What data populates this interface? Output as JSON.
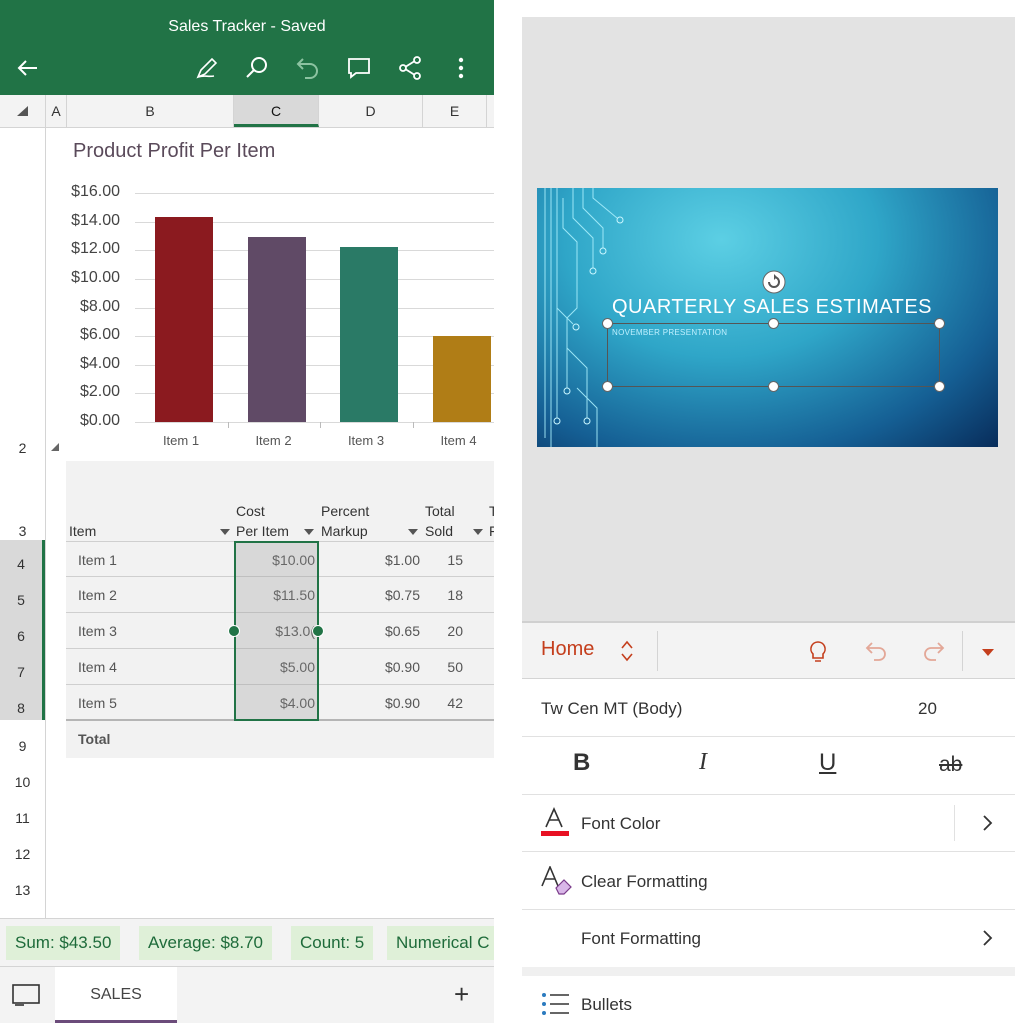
{
  "excel": {
    "title": "Sales Tracker - Saved",
    "toolbar_icons": [
      "back-arrow-icon",
      "pen-icon",
      "search-icon",
      "undo-icon",
      "comment-icon",
      "share-icon",
      "more-icon"
    ],
    "columns": [
      {
        "label": "A",
        "selected": false
      },
      {
        "label": "B",
        "selected": false
      },
      {
        "label": "C",
        "selected": true
      },
      {
        "label": "D",
        "selected": false
      },
      {
        "label": "E",
        "selected": false
      }
    ],
    "rows": [
      "2",
      "3",
      "4",
      "5",
      "6",
      "7",
      "8",
      "9",
      "10",
      "11",
      "12",
      "13"
    ],
    "selected_rows": [
      "4",
      "5",
      "6",
      "7",
      "8"
    ],
    "chart": {
      "title": "Product Profit Per Item",
      "y_ticks": [
        "$16.00",
        "$14.00",
        "$12.00",
        "$10.00",
        "$8.00",
        "$6.00",
        "$4.00",
        "$2.00",
        "$0.00"
      ],
      "categories": [
        "Item 1",
        "Item 2",
        "Item 3",
        "Item 4"
      ],
      "values": [
        14.3,
        12.9,
        12.2,
        6.0
      ],
      "colors": [
        "#8b1a1f",
        "#604a66",
        "#2a7a66",
        "#b07d16"
      ],
      "ylim": [
        0,
        16
      ]
    },
    "table": {
      "headers": {
        "item": "Item",
        "cost_line1": "Cost",
        "cost_line2": "Per Item",
        "markup_line1": "Percent",
        "markup_line2": "Markup",
        "sold_line1": "Total",
        "sold_line2": "Sold",
        "extra_line1": "T",
        "extra_line2": "F"
      },
      "rows": [
        {
          "item": "Item 1",
          "cost": "$10.00",
          "markup": "$1.00",
          "sold": "15"
        },
        {
          "item": "Item 2",
          "cost": "$11.50",
          "markup": "$0.75",
          "sold": "18"
        },
        {
          "item": "Item 3",
          "cost": "$13.0(",
          "markup": "$0.65",
          "sold": "20"
        },
        {
          "item": "Item 4",
          "cost": "$5.00",
          "markup": "$0.90",
          "sold": "50"
        },
        {
          "item": "Item 5",
          "cost": "$4.00",
          "markup": "$0.90",
          "sold": "42"
        }
      ],
      "total_label": "Total"
    },
    "status": {
      "sum": "Sum: $43.50",
      "average": "Average: $8.70",
      "count": "Count: 5",
      "numerical": "Numerical C"
    },
    "sheet_tab": "SALES",
    "add_sheet": "+"
  },
  "ppt": {
    "slide": {
      "title": "QUARTERLY SALES ESTIMATES",
      "subtitle": "NOVEMBER PRESENTATION"
    },
    "ribbon": {
      "tab": "Home"
    },
    "font": {
      "name": "Tw Cen MT (Body)",
      "size": "20"
    },
    "format_buttons": {
      "bold": "B",
      "italic": "I",
      "underline": "U",
      "strike": "ab"
    },
    "menu": {
      "font_color": "Font Color",
      "clear_formatting": "Clear Formatting",
      "font_formatting": "Font Formatting",
      "bullets": "Bullets"
    },
    "colors": {
      "accent": "#c43e1c",
      "font_color_swatch": "#e81123"
    }
  }
}
